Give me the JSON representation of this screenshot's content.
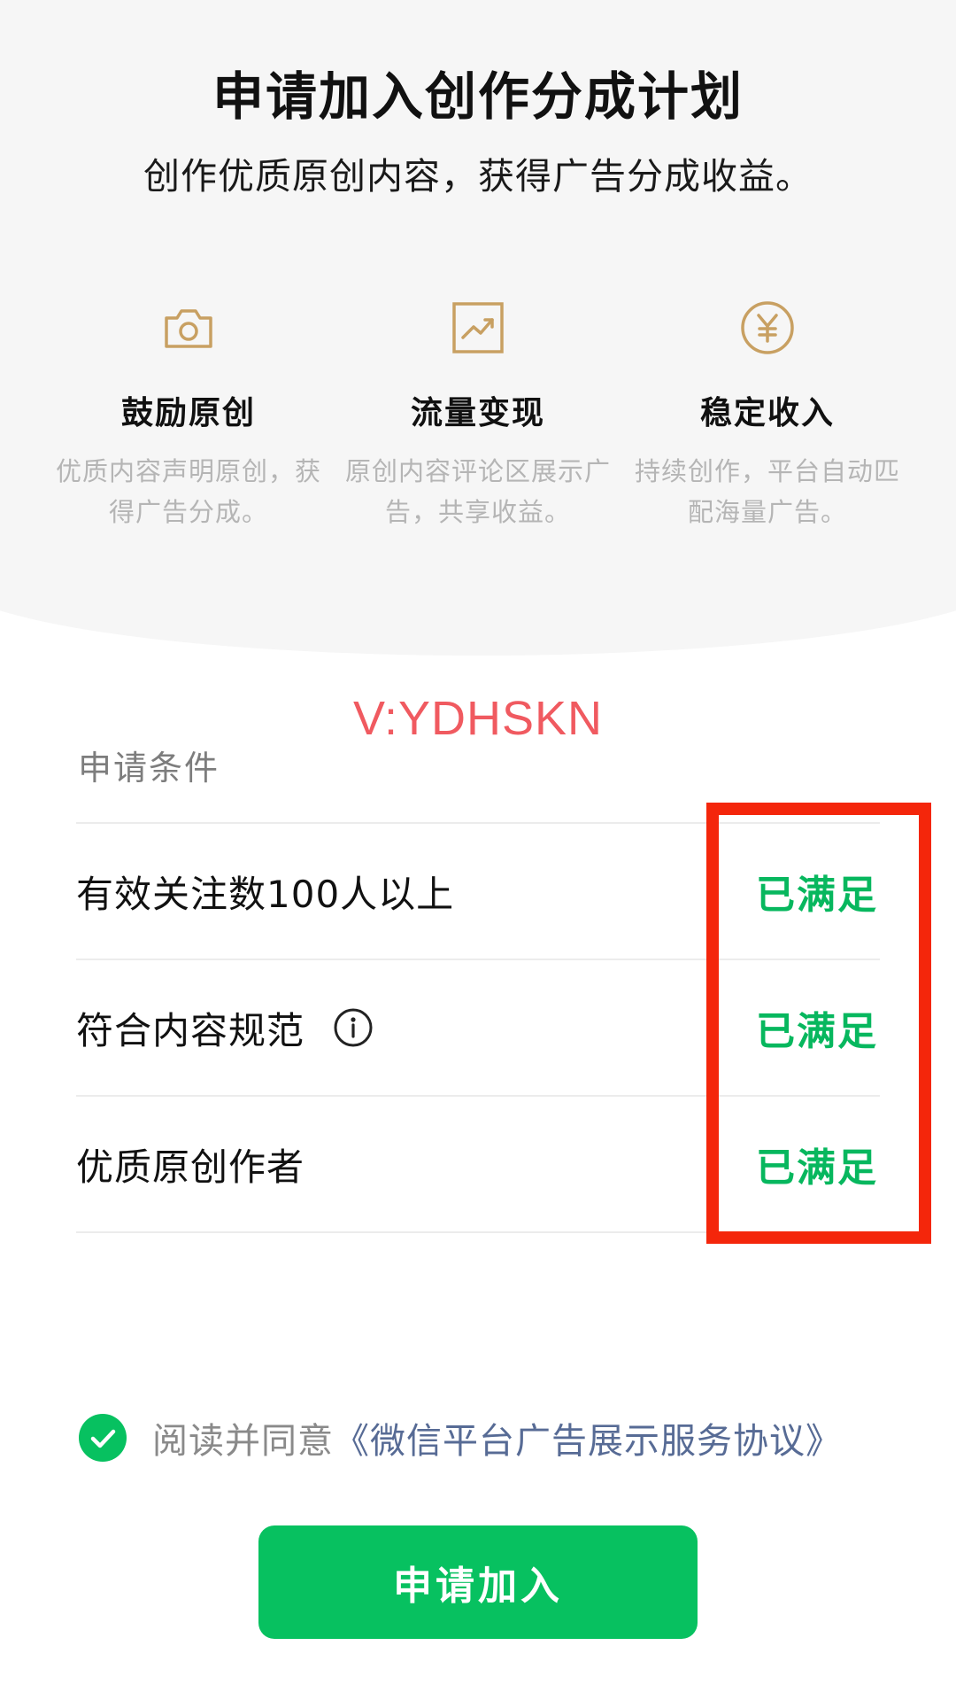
{
  "header": {
    "title": "申请加入创作分成计划",
    "subtitle": "创作优质原创内容，获得广告分成收益。"
  },
  "features": [
    {
      "icon": "camera-icon",
      "title": "鼓励原创",
      "desc": "优质内容声明原创，获得广告分成。"
    },
    {
      "icon": "trend-chart-icon",
      "title": "流量变现",
      "desc": "原创内容评论区展示广告，共享收益。"
    },
    {
      "icon": "yen-coin-icon",
      "title": "稳定收入",
      "desc": "持续创作，平台自动匹配海量广告。"
    }
  ],
  "watermark": "V:YDHSKN",
  "conditions": {
    "label": "申请条件",
    "items": [
      {
        "label": "有效关注数100人以上",
        "status": "已满足"
      },
      {
        "label": "符合内容规范",
        "status": "已满足",
        "icon": "info-icon"
      },
      {
        "label": "优质原创作者",
        "status": "已满足"
      }
    ]
  },
  "agreement": {
    "checked": true,
    "text": "阅读并同意",
    "link": "《微信平台广告展示服务协议》"
  },
  "apply_button": "申请加入",
  "colors": {
    "accent_gold": "#c8a062",
    "brand_green": "#07c160",
    "status_green": "#07b75e",
    "link_blue": "#576b95",
    "highlight_red": "#f4260b",
    "watermark_red": "#f05a60"
  }
}
